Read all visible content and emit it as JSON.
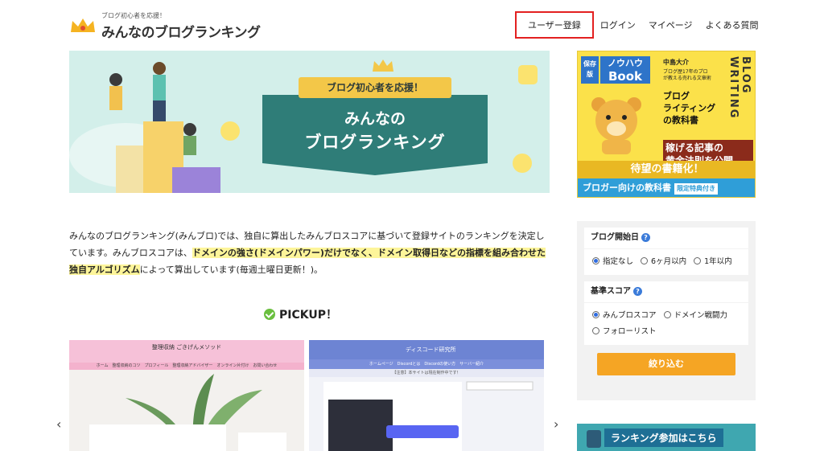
{
  "header": {
    "tagline": "ブログ初心者を応援！",
    "site_title": "みんなのブログランキング",
    "nav": [
      "ユーザー登録",
      "ログイン",
      "マイページ",
      "よくある質問"
    ]
  },
  "hero": {
    "ribbon": "ブログ初心者を応援！",
    "line1": "みんなの",
    "line2": "ブログランキング"
  },
  "ad": {
    "badge": "保存版",
    "knowhow": "ノウハウ",
    "knowhow_book": "Book",
    "author": "中島大介",
    "copy": "ブログ歴17年のプロが教える売れる文章術",
    "book_title_1": "ブログ",
    "book_title_2": "ライティング",
    "book_title_3": "の教科書",
    "side_text": "BLOG WRITING",
    "big_1": "稼げる記事の",
    "big_2": "黄金法則を公開",
    "bottom1": "待望の書籍化！",
    "bottom2": "ブロガー向けの教科書",
    "bottom2_tag": "限定特典付き"
  },
  "intro": {
    "p1": "みんなのブログランキング(みんブロ)では、独自に算出したみんブロスコアに基づいて登録サイトのランキングを決定しています。みんブロスコアは、",
    "mark1": "ドメインの強さ(ドメインパワー)だけでなく、ドメイン取得日などの指標を組み合わせた独自アルゴリズム",
    "p2": "によって算出しています(毎週土曜日更新！)。"
  },
  "pickup": {
    "title": "PICKUP！"
  },
  "cards": [
    {
      "header": "整理収納 ごきげんメソッド",
      "nav": "ホーム　整理収納のコツ　プロフィール　整理収納アドバイザー　オンライン片付け　お問い合わせ"
    },
    {
      "header": "ディスコード研究所",
      "nav": "ホームページ　Discordとは　Discordの使い方　サーバー紹介",
      "sub": "【注意】本サイトは現在制作中です！"
    }
  ],
  "filter": {
    "blog_start_label": "ブログ開始日",
    "blog_start_options": [
      "指定なし",
      "6ヶ月以内",
      "1年以内"
    ],
    "score_label": "基準スコア",
    "score_options": [
      "みんブロスコア",
      "ドメイン戦闘力",
      "フォローリスト"
    ],
    "submit": "絞り込む"
  },
  "rank_banner": {
    "text": "ランキング参加はこちら"
  },
  "colors": {
    "accent_orange": "#f5a524",
    "hero_teal": "#2f7d78",
    "highlight_red": "#e32020"
  }
}
